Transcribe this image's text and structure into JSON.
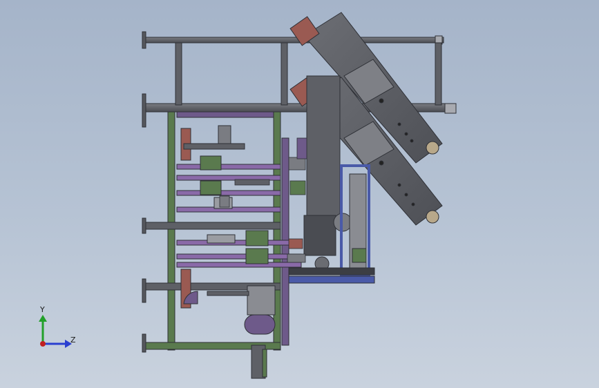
{
  "viewport": {
    "background_top": "#a5b4c9",
    "background_bottom": "#c9d2de"
  },
  "colors": {
    "steel": "#5e6066",
    "steel_dark": "#3c3e44",
    "steel_light": "#8a8c92",
    "green_part": "#5a7a4e",
    "purple_part": "#6e5a8a",
    "blue_part": "#4a5aa8",
    "red_part": "#9a5a52"
  },
  "triad": {
    "y_label": "Y",
    "z_label": "Z",
    "y_color": "#22a02a",
    "z_color": "#2a3fd0",
    "x_color": "#c02020"
  }
}
